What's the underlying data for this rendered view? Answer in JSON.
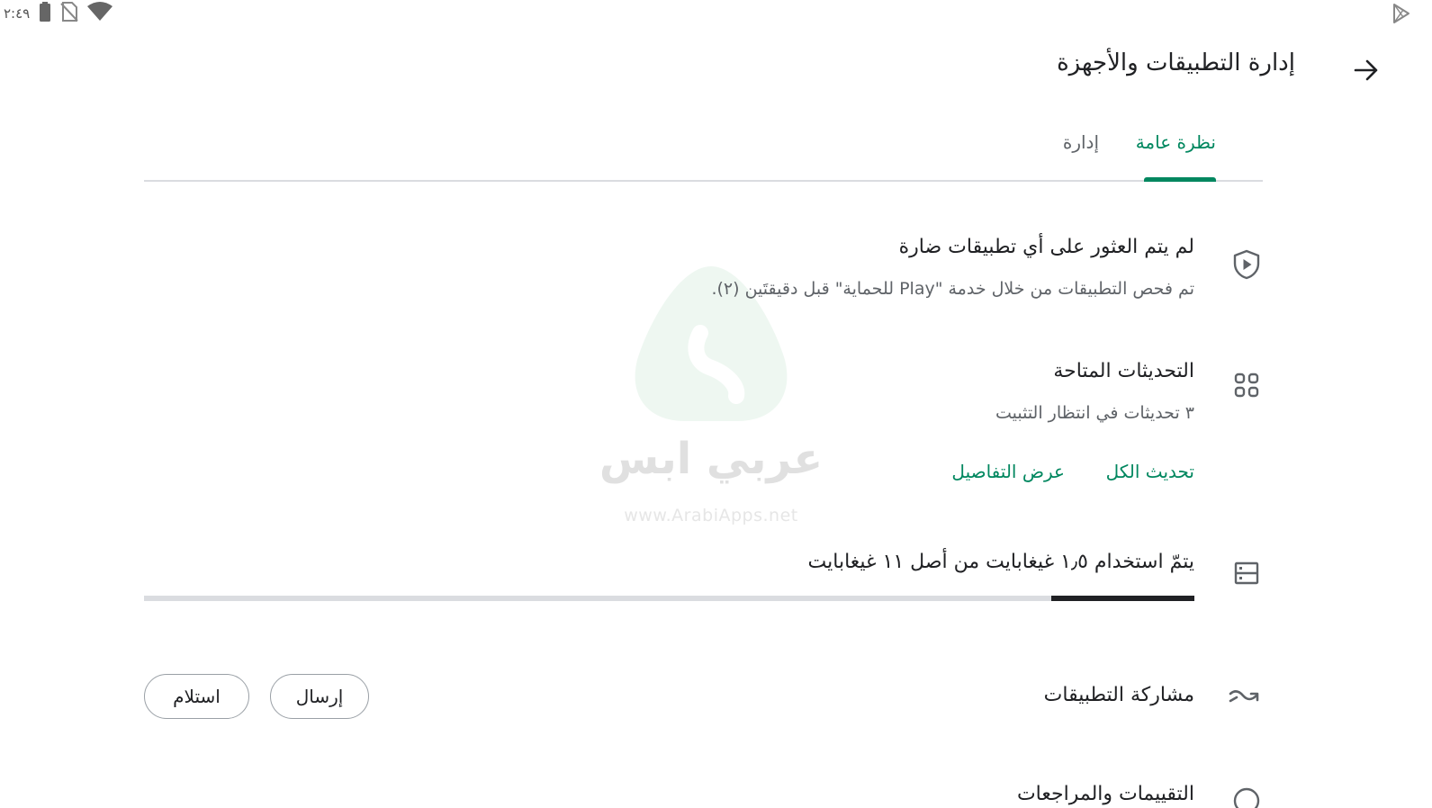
{
  "status_bar": {
    "time": "٢:٤٩",
    "icons": [
      "battery-icon",
      "no-sim-icon",
      "wifi-icon"
    ],
    "right_icon": "play-store-icon"
  },
  "header": {
    "title": "إدارة التطبيقات والأجهزة",
    "back_icon": "arrow-back-icon"
  },
  "tabs": [
    {
      "label": "نظرة عامة",
      "active": true
    },
    {
      "label": "إدارة",
      "active": false
    }
  ],
  "protection": {
    "icon": "play-protect-icon",
    "title": "لم يتم العثور على أي تطبيقات ضارة",
    "subtitle": "تم فحص التطبيقات من خلال خدمة \"Play للحماية\" قبل دقيقتَين (٢)."
  },
  "updates": {
    "icon": "apps-grid-icon",
    "title": "التحديثات المتاحة",
    "subtitle": "٣ تحديثات في انتظار التثبيت",
    "update_all": "تحديث الكل",
    "see_details": "عرض التفاصيل"
  },
  "storage": {
    "icon": "storage-icon",
    "title": "يتمّ استخدام ١٫٥ غيغابايت من أصل ١١ غيغابايت",
    "used_gb": 1.5,
    "total_gb": 11
  },
  "share": {
    "icon": "share-apps-icon",
    "title": "مشاركة التطبيقات",
    "send_label": "إرسال",
    "receive_label": "استلام"
  },
  "next_section": {
    "title": "التقييمات والمراجعات"
  },
  "watermark": {
    "brand": "عربي ابس",
    "url": "www.ArabiApps.net"
  },
  "colors": {
    "accent": "#01875f",
    "text": "#202124",
    "secondary": "#5f6368",
    "divider": "#dadce0"
  }
}
